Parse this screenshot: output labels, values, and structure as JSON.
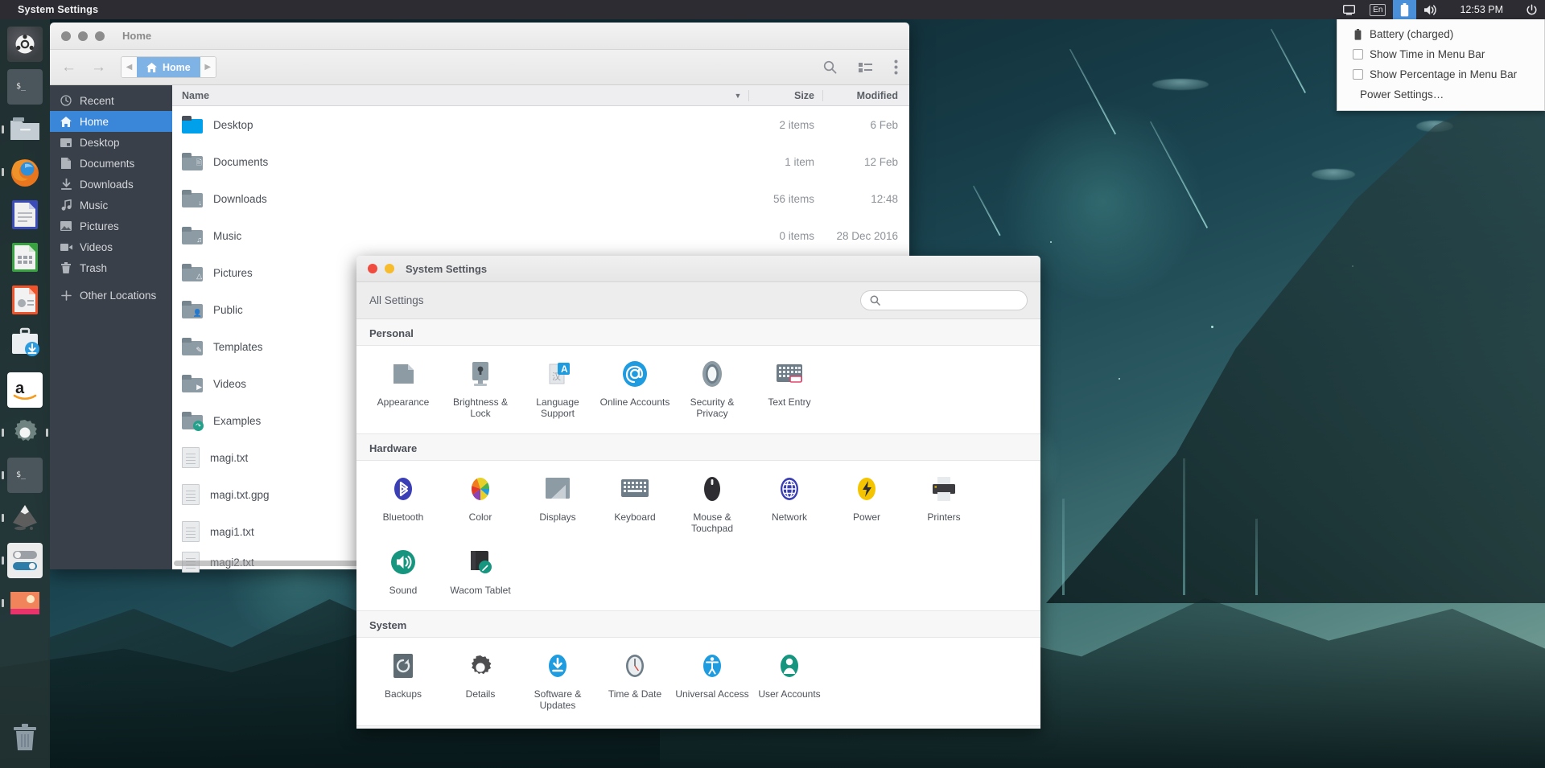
{
  "panel": {
    "title": "System Settings",
    "tray": [
      {
        "name": "display-icon",
        "type": "icon",
        "label": ""
      },
      {
        "name": "keyboard-layout-indicator",
        "type": "text",
        "label": "En"
      },
      {
        "name": "battery-icon",
        "type": "icon",
        "label": "",
        "active": true
      },
      {
        "name": "volume-icon",
        "type": "icon",
        "label": ""
      }
    ],
    "clock": "12:53 PM",
    "power_icon": "power-icon"
  },
  "battery_menu": {
    "status": "Battery (charged)",
    "items": [
      {
        "label": "Show Time in Menu Bar",
        "checked": false
      },
      {
        "label": "Show Percentage in Menu Bar",
        "checked": false
      }
    ],
    "settings_item": "Power Settings…"
  },
  "launcher": {
    "items": [
      {
        "name": "ubuntu-dash-icon",
        "label": "Ubuntu Dash",
        "running": false
      },
      {
        "name": "terminal-icon",
        "label": "Terminal",
        "running": false
      },
      {
        "name": "files-icon",
        "label": "Files",
        "running": true
      },
      {
        "name": "firefox-icon",
        "label": "Firefox",
        "running": true
      },
      {
        "name": "libreoffice-writer-icon",
        "label": "LibreOffice Writer",
        "running": false
      },
      {
        "name": "libreoffice-calc-icon",
        "label": "LibreOffice Calc",
        "running": false
      },
      {
        "name": "libreoffice-impress-icon",
        "label": "LibreOffice Impress",
        "running": false
      },
      {
        "name": "software-center-icon",
        "label": "Ubuntu Software",
        "running": false
      },
      {
        "name": "amazon-icon",
        "label": "Amazon",
        "running": false
      },
      {
        "name": "system-settings-icon",
        "label": "System Settings",
        "running": true,
        "focused": true
      },
      {
        "name": "terminal-icon-2",
        "label": "Terminal",
        "running": true
      },
      {
        "name": "inkscape-icon",
        "label": "Inkscape",
        "running": true
      },
      {
        "name": "unity-tweak-tool-icon",
        "label": "Unity Tweak Tool",
        "running": true
      },
      {
        "name": "shotwell-icon",
        "label": "Shotwell",
        "running": true
      },
      {
        "name": "trash-icon",
        "label": "Trash",
        "running": false
      }
    ]
  },
  "file_manager": {
    "title": "Home",
    "breadcrumb": "Home",
    "toolbar_icons": [
      "search-icon",
      "list-view-icon",
      "menu-icon"
    ],
    "sidebar": [
      {
        "label": "Recent",
        "icon": "clock-icon",
        "selected": false
      },
      {
        "label": "Home",
        "icon": "home-icon",
        "selected": true
      },
      {
        "label": "Desktop",
        "icon": "desktop-icon",
        "selected": false
      },
      {
        "label": "Documents",
        "icon": "document-icon",
        "selected": false
      },
      {
        "label": "Downloads",
        "icon": "download-icon",
        "selected": false
      },
      {
        "label": "Music",
        "icon": "music-icon",
        "selected": false
      },
      {
        "label": "Pictures",
        "icon": "picture-icon",
        "selected": false
      },
      {
        "label": "Videos",
        "icon": "video-icon",
        "selected": false
      },
      {
        "label": "Trash",
        "icon": "trash-icon",
        "selected": false
      },
      {
        "label": "Other Locations",
        "icon": "plus-icon",
        "selected": false
      }
    ],
    "columns": [
      "Name",
      "Size",
      "Modified"
    ],
    "rows": [
      {
        "name": "Desktop",
        "icon": "folder-desktop",
        "size": "2 items",
        "modified": "6 Feb"
      },
      {
        "name": "Documents",
        "icon": "folder-documents",
        "size": "1 item",
        "modified": "12 Feb"
      },
      {
        "name": "Downloads",
        "icon": "folder-downloads",
        "size": "56 items",
        "modified": "12:48"
      },
      {
        "name": "Music",
        "icon": "folder-music",
        "size": "0 items",
        "modified": "28 Dec 2016"
      },
      {
        "name": "Pictures",
        "icon": "folder-pictures",
        "size": "",
        "modified": ""
      },
      {
        "name": "Public",
        "icon": "folder-public",
        "size": "",
        "modified": ""
      },
      {
        "name": "Templates",
        "icon": "folder-templates",
        "size": "",
        "modified": ""
      },
      {
        "name": "Videos",
        "icon": "folder-videos",
        "size": "",
        "modified": ""
      },
      {
        "name": "Examples",
        "icon": "folder-link",
        "size": "",
        "modified": ""
      },
      {
        "name": "magi.txt",
        "icon": "text-file",
        "size": "",
        "modified": ""
      },
      {
        "name": "magi.txt.gpg",
        "icon": "text-file",
        "size": "",
        "modified": ""
      },
      {
        "name": "magi1.txt",
        "icon": "text-file",
        "size": "",
        "modified": ""
      },
      {
        "name": "magi2.txt",
        "icon": "text-file",
        "size": "",
        "modified": ""
      }
    ]
  },
  "system_settings": {
    "title": "System Settings",
    "all_settings_label": "All Settings",
    "search_placeholder": "",
    "sections": [
      {
        "label": "Personal",
        "items": [
          {
            "label": "Appearance",
            "icon": "appearance-icon"
          },
          {
            "label": "Brightness & Lock",
            "icon": "brightness-lock-icon"
          },
          {
            "label": "Language Support",
            "icon": "language-support-icon"
          },
          {
            "label": "Online Accounts",
            "icon": "online-accounts-icon"
          },
          {
            "label": "Security & Privacy",
            "icon": "security-privacy-icon"
          },
          {
            "label": "Text Entry",
            "icon": "text-entry-icon"
          }
        ]
      },
      {
        "label": "Hardware",
        "items": [
          {
            "label": "Bluetooth",
            "icon": "bluetooth-icon"
          },
          {
            "label": "Color",
            "icon": "color-icon"
          },
          {
            "label": "Displays",
            "icon": "displays-icon"
          },
          {
            "label": "Keyboard",
            "icon": "keyboard-icon"
          },
          {
            "label": "Mouse & Touchpad",
            "icon": "mouse-touchpad-icon"
          },
          {
            "label": "Network",
            "icon": "network-icon"
          },
          {
            "label": "Power",
            "icon": "power-settings-icon"
          },
          {
            "label": "Printers",
            "icon": "printers-icon"
          },
          {
            "label": "Sound",
            "icon": "sound-icon"
          },
          {
            "label": "Wacom Tablet",
            "icon": "wacom-tablet-icon"
          }
        ]
      },
      {
        "label": "System",
        "items": [
          {
            "label": "Backups",
            "icon": "backups-icon"
          },
          {
            "label": "Details",
            "icon": "details-icon"
          },
          {
            "label": "Software & Updates",
            "icon": "software-updates-icon"
          },
          {
            "label": "Time & Date",
            "icon": "time-date-icon"
          },
          {
            "label": "Universal Access",
            "icon": "universal-access-icon"
          },
          {
            "label": "User Accounts",
            "icon": "user-accounts-icon"
          }
        ]
      }
    ]
  },
  "colors": {
    "panel_bg": "#2c2c32",
    "accent_blue": "#4a90d9",
    "selection_blue": "#3a86d9",
    "launcher_bg": "#263434"
  }
}
